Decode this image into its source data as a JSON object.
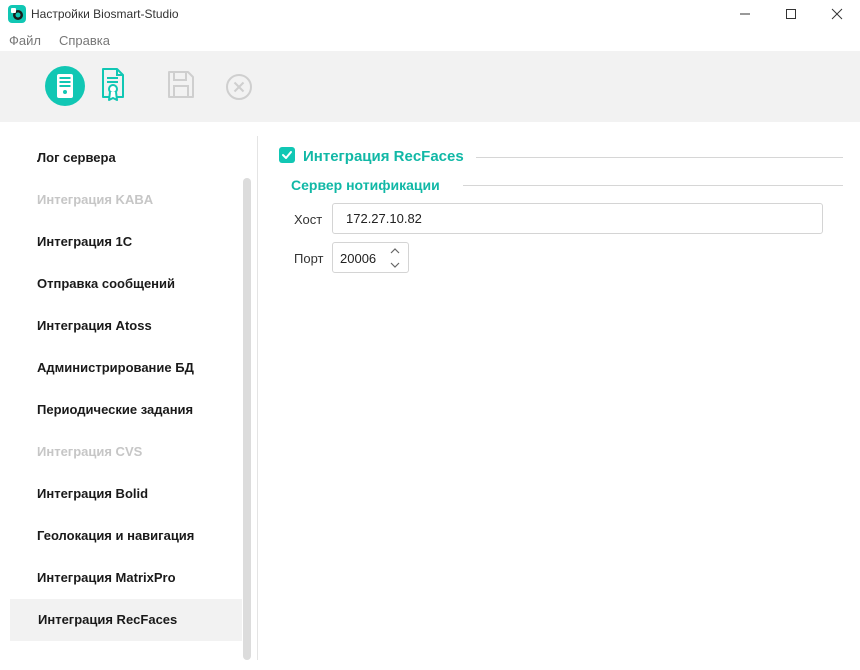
{
  "window": {
    "title": "Настройки Biosmart-Studio"
  },
  "menu": {
    "file": "Файл",
    "help": "Справка"
  },
  "toolbar": {
    "icons": [
      "server-icon",
      "certificate-icon",
      "save-icon",
      "cancel-icon"
    ],
    "active_color": "#11c7b4"
  },
  "sidebar": {
    "items": [
      {
        "label": "Лог сервера",
        "state": "normal"
      },
      {
        "label": "Интеграция KABA",
        "state": "disabled"
      },
      {
        "label": "Интеграция 1С",
        "state": "normal"
      },
      {
        "label": "Отправка сообщений",
        "state": "normal"
      },
      {
        "label": "Интеграция Atoss",
        "state": "normal"
      },
      {
        "label": "Администрирование БД",
        "state": "normal"
      },
      {
        "label": "Периодические задания",
        "state": "normal"
      },
      {
        "label": "Интеграция CVS",
        "state": "disabled"
      },
      {
        "label": "Интеграция Bolid",
        "state": "normal"
      },
      {
        "label": "Геолокация и навигация",
        "state": "normal"
      },
      {
        "label": "Интеграция MatrixPro",
        "state": "normal"
      },
      {
        "label": "Интеграция RecFaces",
        "state": "active"
      }
    ]
  },
  "content": {
    "section_title": "Интеграция RecFaces",
    "enabled": true,
    "group_title": "Сервер нотификации",
    "host_label": "Хост",
    "host_value": "172.27.10.82",
    "port_label": "Порт",
    "port_value": "20006",
    "accent_color": "#11b8a6"
  }
}
